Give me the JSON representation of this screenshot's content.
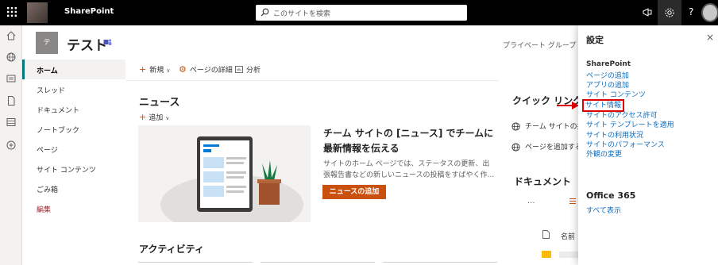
{
  "topbar": {
    "app_name": "SharePoint",
    "search_placeholder": "このサイトを検索",
    "help_label": "?"
  },
  "site": {
    "logo_letter": "テ",
    "title": "テスト",
    "privacy_label": "プライベート グループ"
  },
  "leftnav": {
    "items": [
      {
        "label": "ホーム",
        "active": true
      },
      {
        "label": "スレッド"
      },
      {
        "label": "ドキュメント"
      },
      {
        "label": "ノートブック"
      },
      {
        "label": "ページ"
      },
      {
        "label": "サイト コンテンツ"
      },
      {
        "label": "ごみ箱"
      },
      {
        "label": "編集"
      }
    ]
  },
  "commandbar": {
    "new_label": "新規",
    "page_details_label": "ページの詳細",
    "analytics_label": "分析"
  },
  "news": {
    "heading": "ニュース",
    "add_label": "追加",
    "card_title": "チーム サイトの [ニュース] でチームに最新情報を伝える",
    "card_description": "サイトのホーム ページでは、ステータスの更新、出張報告書などの新しいニュースの投稿をすばやく作...",
    "add_news_button": "ニュースの追加"
  },
  "activity": {
    "heading": "アクティビティ"
  },
  "quicklinks": {
    "heading": "クイック リンク",
    "items": [
      "チーム サイトの共",
      "ページを追加する"
    ]
  },
  "documents": {
    "heading": "ドキュメント",
    "more": "...",
    "name_column": "名前"
  },
  "settings_panel": {
    "title": "設定",
    "close": "×",
    "section": "SharePoint",
    "links": [
      "ページの追加",
      "アプリの追加",
      "サイト コンテンツ",
      "サイト情報",
      "サイトのアクセス許可",
      "サイト テンプレートを適用",
      "サイトの利用状況",
      "サイトのパフォーマンス",
      "外観の変更"
    ],
    "highlighted_link": "サイト情報",
    "office_heading": "Office 365",
    "show_all": "すべて表示"
  },
  "colors": {
    "accent": "#ca5010",
    "link": "#0f6cbd",
    "nav_active_bar": "#03787c",
    "highlight": "#e00000"
  }
}
